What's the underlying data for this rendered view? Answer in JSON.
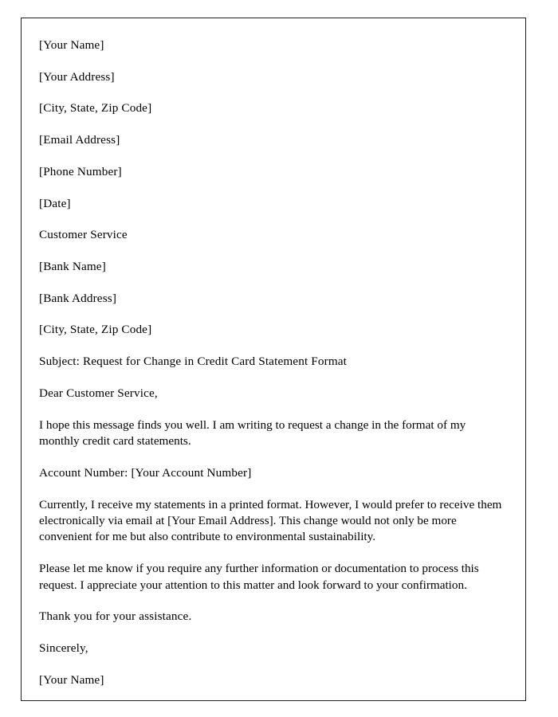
{
  "document": {
    "sender": {
      "name": "[Your Name]",
      "address": "[Your Address]",
      "city_state_zip": "[City, State, Zip Code]",
      "email": "[Email Address]",
      "phone": "[Phone Number]",
      "date": "[Date]"
    },
    "recipient": {
      "department": "Customer Service",
      "bank_name": "[Bank Name]",
      "bank_address": "[Bank Address]",
      "city_state_zip": "[City, State, Zip Code]"
    },
    "subject": "Subject: Request for Change in Credit Card Statement Format",
    "salutation": "Dear Customer Service,",
    "paragraph_1": "I hope this message finds you well. I am writing to request a change in the format of my monthly credit card statements.",
    "account_number": "Account Number: [Your Account Number]",
    "paragraph_2": "Currently, I receive my statements in a printed format. However, I would prefer to receive them electronically via email at [Your Email Address]. This change would not only be more convenient for me but also contribute to environmental sustainability.",
    "paragraph_3": "Please let me know if you require any further information or documentation to process this request. I appreciate your attention to this matter and look forward to your confirmation.",
    "closing_thanks": "Thank you for your assistance.",
    "closing": "Sincerely,",
    "signature_name": "[Your Name]"
  }
}
